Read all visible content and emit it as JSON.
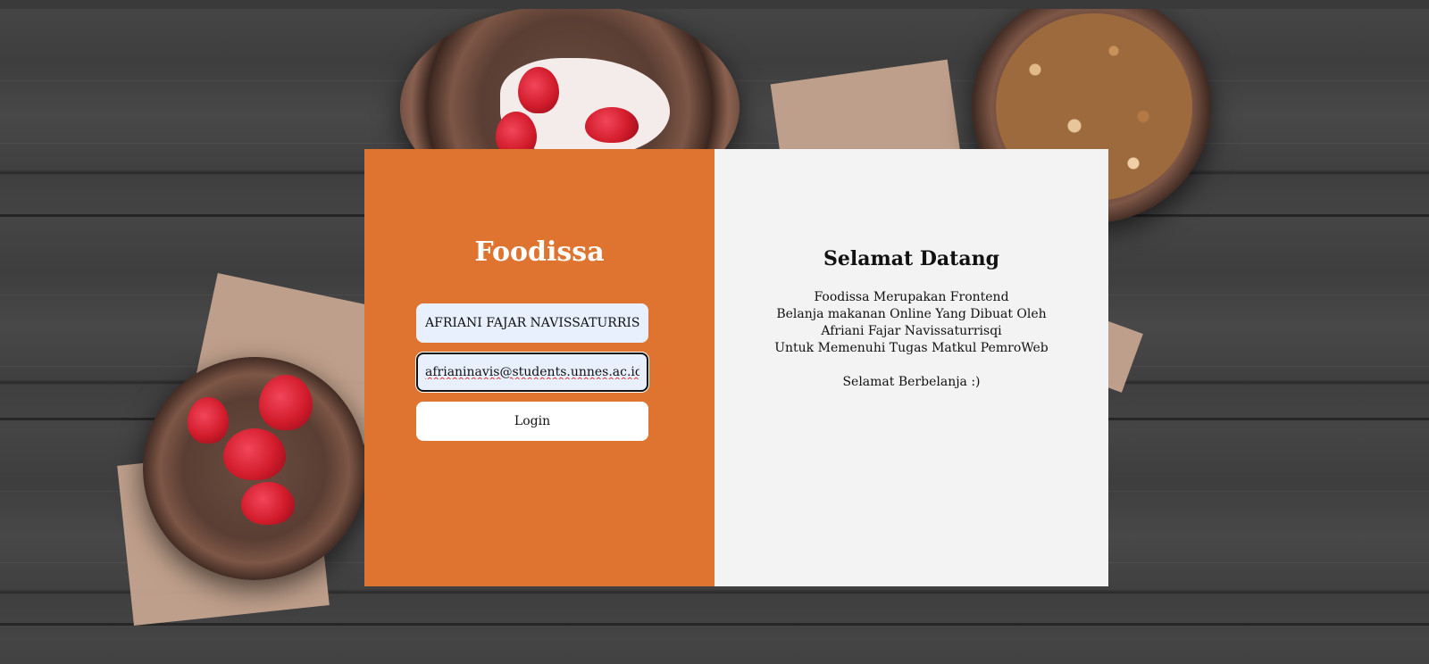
{
  "brand": {
    "title": "Foodissa"
  },
  "login_form": {
    "name_value": "AFRIANI FAJAR NAVISSATURRISQI",
    "email_value": "afrianinavis@students.unnes.ac.id",
    "login_label": "Login"
  },
  "welcome": {
    "title": "Selamat Datang",
    "lines": [
      "Foodissa Merupakan Frontend",
      "Belanja makanan Online Yang Dibuat Oleh",
      "Afriani Fajar Navissaturrisqi",
      "Untuk Memenuhi Tugas Matkul PemroWeb"
    ],
    "closing": "Selamat Berbelanja :)"
  },
  "colors": {
    "accent": "#de7430",
    "panel": "#f3f3f3",
    "autofill": "#e8f0fe"
  }
}
